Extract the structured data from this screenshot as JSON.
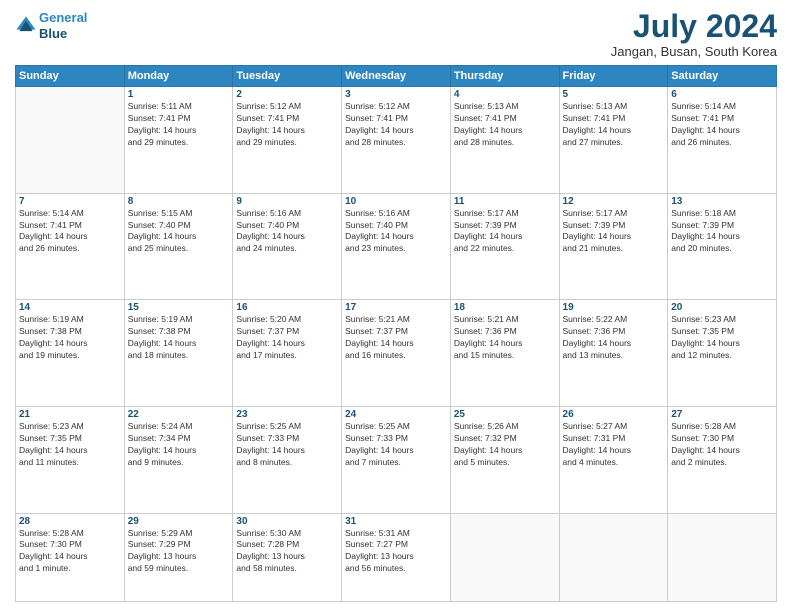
{
  "logo": {
    "line1": "General",
    "line2": "Blue"
  },
  "title": "July 2024",
  "location": "Jangan, Busan, South Korea",
  "days_of_week": [
    "Sunday",
    "Monday",
    "Tuesday",
    "Wednesday",
    "Thursday",
    "Friday",
    "Saturday"
  ],
  "weeks": [
    [
      {
        "day": "",
        "info": ""
      },
      {
        "day": "1",
        "info": "Sunrise: 5:11 AM\nSunset: 7:41 PM\nDaylight: 14 hours\nand 29 minutes."
      },
      {
        "day": "2",
        "info": "Sunrise: 5:12 AM\nSunset: 7:41 PM\nDaylight: 14 hours\nand 29 minutes."
      },
      {
        "day": "3",
        "info": "Sunrise: 5:12 AM\nSunset: 7:41 PM\nDaylight: 14 hours\nand 28 minutes."
      },
      {
        "day": "4",
        "info": "Sunrise: 5:13 AM\nSunset: 7:41 PM\nDaylight: 14 hours\nand 28 minutes."
      },
      {
        "day": "5",
        "info": "Sunrise: 5:13 AM\nSunset: 7:41 PM\nDaylight: 14 hours\nand 27 minutes."
      },
      {
        "day": "6",
        "info": "Sunrise: 5:14 AM\nSunset: 7:41 PM\nDaylight: 14 hours\nand 26 minutes."
      }
    ],
    [
      {
        "day": "7",
        "info": "Sunrise: 5:14 AM\nSunset: 7:41 PM\nDaylight: 14 hours\nand 26 minutes."
      },
      {
        "day": "8",
        "info": "Sunrise: 5:15 AM\nSunset: 7:40 PM\nDaylight: 14 hours\nand 25 minutes."
      },
      {
        "day": "9",
        "info": "Sunrise: 5:16 AM\nSunset: 7:40 PM\nDaylight: 14 hours\nand 24 minutes."
      },
      {
        "day": "10",
        "info": "Sunrise: 5:16 AM\nSunset: 7:40 PM\nDaylight: 14 hours\nand 23 minutes."
      },
      {
        "day": "11",
        "info": "Sunrise: 5:17 AM\nSunset: 7:39 PM\nDaylight: 14 hours\nand 22 minutes."
      },
      {
        "day": "12",
        "info": "Sunrise: 5:17 AM\nSunset: 7:39 PM\nDaylight: 14 hours\nand 21 minutes."
      },
      {
        "day": "13",
        "info": "Sunrise: 5:18 AM\nSunset: 7:39 PM\nDaylight: 14 hours\nand 20 minutes."
      }
    ],
    [
      {
        "day": "14",
        "info": "Sunrise: 5:19 AM\nSunset: 7:38 PM\nDaylight: 14 hours\nand 19 minutes."
      },
      {
        "day": "15",
        "info": "Sunrise: 5:19 AM\nSunset: 7:38 PM\nDaylight: 14 hours\nand 18 minutes."
      },
      {
        "day": "16",
        "info": "Sunrise: 5:20 AM\nSunset: 7:37 PM\nDaylight: 14 hours\nand 17 minutes."
      },
      {
        "day": "17",
        "info": "Sunrise: 5:21 AM\nSunset: 7:37 PM\nDaylight: 14 hours\nand 16 minutes."
      },
      {
        "day": "18",
        "info": "Sunrise: 5:21 AM\nSunset: 7:36 PM\nDaylight: 14 hours\nand 15 minutes."
      },
      {
        "day": "19",
        "info": "Sunrise: 5:22 AM\nSunset: 7:36 PM\nDaylight: 14 hours\nand 13 minutes."
      },
      {
        "day": "20",
        "info": "Sunrise: 5:23 AM\nSunset: 7:35 PM\nDaylight: 14 hours\nand 12 minutes."
      }
    ],
    [
      {
        "day": "21",
        "info": "Sunrise: 5:23 AM\nSunset: 7:35 PM\nDaylight: 14 hours\nand 11 minutes."
      },
      {
        "day": "22",
        "info": "Sunrise: 5:24 AM\nSunset: 7:34 PM\nDaylight: 14 hours\nand 9 minutes."
      },
      {
        "day": "23",
        "info": "Sunrise: 5:25 AM\nSunset: 7:33 PM\nDaylight: 14 hours\nand 8 minutes."
      },
      {
        "day": "24",
        "info": "Sunrise: 5:25 AM\nSunset: 7:33 PM\nDaylight: 14 hours\nand 7 minutes."
      },
      {
        "day": "25",
        "info": "Sunrise: 5:26 AM\nSunset: 7:32 PM\nDaylight: 14 hours\nand 5 minutes."
      },
      {
        "day": "26",
        "info": "Sunrise: 5:27 AM\nSunset: 7:31 PM\nDaylight: 14 hours\nand 4 minutes."
      },
      {
        "day": "27",
        "info": "Sunrise: 5:28 AM\nSunset: 7:30 PM\nDaylight: 14 hours\nand 2 minutes."
      }
    ],
    [
      {
        "day": "28",
        "info": "Sunrise: 5:28 AM\nSunset: 7:30 PM\nDaylight: 14 hours\nand 1 minute."
      },
      {
        "day": "29",
        "info": "Sunrise: 5:29 AM\nSunset: 7:29 PM\nDaylight: 13 hours\nand 59 minutes."
      },
      {
        "day": "30",
        "info": "Sunrise: 5:30 AM\nSunset: 7:28 PM\nDaylight: 13 hours\nand 58 minutes."
      },
      {
        "day": "31",
        "info": "Sunrise: 5:31 AM\nSunset: 7:27 PM\nDaylight: 13 hours\nand 56 minutes."
      },
      {
        "day": "",
        "info": ""
      },
      {
        "day": "",
        "info": ""
      },
      {
        "day": "",
        "info": ""
      }
    ]
  ]
}
